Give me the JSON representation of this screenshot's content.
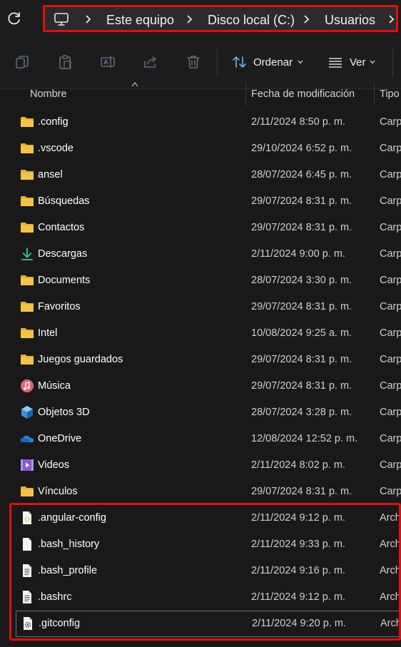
{
  "address_bar": {
    "crumbs": [
      "Este equipo",
      "Disco local (C:)",
      "Usuarios"
    ]
  },
  "toolbar": {
    "sort_label": "Ordenar",
    "view_label": "Ver",
    "icons": [
      "copy-icon",
      "paste-icon",
      "rename-icon",
      "share-icon",
      "delete-icon"
    ]
  },
  "columns": {
    "name": "Nombre",
    "date": "Fecha de modificación",
    "type": "Tipo"
  },
  "files": [
    {
      "name": ".config",
      "date": "2/11/2024 8:50 p. m.",
      "type": "Carp",
      "icon": "folder-icon"
    },
    {
      "name": ".vscode",
      "date": "29/10/2024 6:52 p. m.",
      "type": "Carp",
      "icon": "folder-icon"
    },
    {
      "name": "ansel",
      "date": "28/07/2024 6:45 p. m.",
      "type": "Carp",
      "icon": "folder-icon"
    },
    {
      "name": "Búsquedas",
      "date": "29/07/2024 8:31 p. m.",
      "type": "Carp",
      "icon": "folder-icon"
    },
    {
      "name": "Contactos",
      "date": "29/07/2024 8:31 p. m.",
      "type": "Carp",
      "icon": "folder-icon"
    },
    {
      "name": "Descargas",
      "date": "2/11/2024 9:00 p. m.",
      "type": "Carp",
      "icon": "download-icon"
    },
    {
      "name": "Documents",
      "date": "28/07/2024 3:30 p. m.",
      "type": "Carp",
      "icon": "folder-icon"
    },
    {
      "name": "Favoritos",
      "date": "29/07/2024 8:31 p. m.",
      "type": "Carp",
      "icon": "folder-icon"
    },
    {
      "name": "Intel",
      "date": "10/08/2024 9:25 a. m.",
      "type": "Carp",
      "icon": "folder-icon"
    },
    {
      "name": "Juegos guardados",
      "date": "29/07/2024 8:31 p. m.",
      "type": "Carp",
      "icon": "folder-icon"
    },
    {
      "name": "Música",
      "date": "29/07/2024 8:31 p. m.",
      "type": "Carp",
      "icon": "music-icon"
    },
    {
      "name": "Objetos 3D",
      "date": "28/07/2024 3:28 p. m.",
      "type": "Carp",
      "icon": "cube-icon"
    },
    {
      "name": "OneDrive",
      "date": "12/08/2024 12:52 p. m.",
      "type": "Carp",
      "icon": "cloud-icon"
    },
    {
      "name": "Videos",
      "date": "2/11/2024 8:02 p. m.",
      "type": "Carp",
      "icon": "video-icon"
    },
    {
      "name": "Vínculos",
      "date": "29/07/2024 8:31 p. m.",
      "type": "Carp",
      "icon": "folder-icon"
    },
    {
      "name": ".angular-config",
      "date": "2/11/2024 9:12 p. m.",
      "type": "Arch",
      "icon": "json-file-icon"
    },
    {
      "name": ".bash_history",
      "date": "2/11/2024 9:33 p. m.",
      "type": "Arch",
      "icon": "file-icon"
    },
    {
      "name": ".bash_profile",
      "date": "2/11/2024 9:16 p. m.",
      "type": "Arch",
      "icon": "text-file-icon"
    },
    {
      "name": ".bashrc",
      "date": "2/11/2024 9:12 p. m.",
      "type": "Arch",
      "icon": "text-file-icon"
    },
    {
      "name": ".gitconfig",
      "date": "2/11/2024 9:20 p. m.",
      "type": "Arch",
      "icon": "config-file-icon"
    }
  ],
  "colors": {
    "highlight_red": "#e30e0e",
    "folder_yellow": "#f6c445",
    "background": "#191919"
  }
}
